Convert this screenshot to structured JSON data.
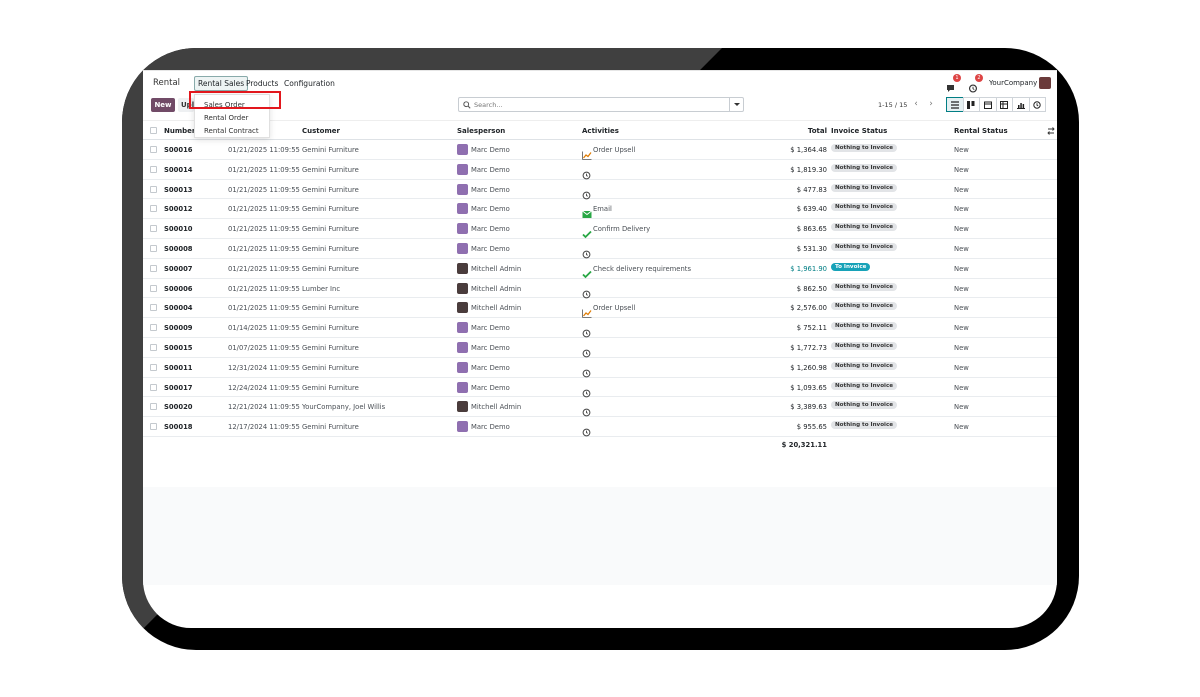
{
  "navbar": {
    "brand": "Rental",
    "menus": [
      "Rental Sales",
      "Products",
      "Configuration"
    ],
    "messages_count": "1",
    "activities_count": "2",
    "company": "YourCompany"
  },
  "dropdown": {
    "items": [
      "Sales Order",
      "Rental Order",
      "Rental Contract"
    ]
  },
  "control": {
    "new_label": "New",
    "upload_label": "Upload",
    "search_placeholder": "Search...",
    "pager": "1-15 / 15"
  },
  "columns": [
    "Number",
    "Customer",
    "Salesperson",
    "Activities",
    "Total",
    "Invoice Status",
    "Rental Status"
  ],
  "rows": [
    {
      "number": "S00016",
      "date": "01/21/2025 11:09:55",
      "customer": "Gemini Furniture",
      "salesperson": "Marc Demo",
      "activity": "Order Upsell",
      "activity_icon": "chart-icon",
      "total": "$ 1,364.48",
      "invoice": "Nothing to Invoice",
      "rental": "New"
    },
    {
      "number": "S00014",
      "date": "01/21/2025 11:09:55",
      "customer": "Gemini Furniture",
      "salesperson": "Marc Demo",
      "activity": "",
      "activity_icon": "clock-icon",
      "total": "$ 1,819.30",
      "invoice": "Nothing to Invoice",
      "rental": "New"
    },
    {
      "number": "S00013",
      "date": "01/21/2025 11:09:55",
      "customer": "Gemini Furniture",
      "salesperson": "Marc Demo",
      "activity": "",
      "activity_icon": "clock-icon",
      "total": "$ 477.83",
      "invoice": "Nothing to Invoice",
      "rental": "New"
    },
    {
      "number": "S00012",
      "date": "01/21/2025 11:09:55",
      "customer": "Gemini Furniture",
      "salesperson": "Marc Demo",
      "activity": "Email",
      "activity_icon": "envelope-icon",
      "total": "$ 639.40",
      "invoice": "Nothing to Invoice",
      "rental": "New"
    },
    {
      "number": "S00010",
      "date": "01/21/2025 11:09:55",
      "customer": "Gemini Furniture",
      "salesperson": "Marc Demo",
      "activity": "Confirm Delivery",
      "activity_icon": "check-icon",
      "total": "$ 863.65",
      "invoice": "Nothing to Invoice",
      "rental": "New"
    },
    {
      "number": "S00008",
      "date": "01/21/2025 11:09:55",
      "customer": "Gemini Furniture",
      "salesperson": "Marc Demo",
      "activity": "",
      "activity_icon": "clock-icon",
      "total": "$ 531.30",
      "invoice": "Nothing to Invoice",
      "rental": "New"
    },
    {
      "number": "S00007",
      "date": "01/21/2025 11:09:55",
      "customer": "Gemini Furniture",
      "salesperson": "Mitchell Admin",
      "activity": "Check delivery requirements",
      "activity_icon": "check-icon",
      "total": "$ 1,961.90",
      "invoice": "To Invoice",
      "rental": "New"
    },
    {
      "number": "S00006",
      "date": "01/21/2025 11:09:55",
      "customer": "Lumber Inc",
      "salesperson": "Mitchell Admin",
      "activity": "",
      "activity_icon": "clock-icon",
      "total": "$ 862.50",
      "invoice": "Nothing to Invoice",
      "rental": "New"
    },
    {
      "number": "S00004",
      "date": "01/21/2025 11:09:55",
      "customer": "Gemini Furniture",
      "salesperson": "Mitchell Admin",
      "activity": "Order Upsell",
      "activity_icon": "chart-icon",
      "total": "$ 2,576.00",
      "invoice": "Nothing to Invoice",
      "rental": "New"
    },
    {
      "number": "S00009",
      "date": "01/14/2025 11:09:55",
      "customer": "Gemini Furniture",
      "salesperson": "Marc Demo",
      "activity": "",
      "activity_icon": "clock-icon",
      "total": "$ 752.11",
      "invoice": "Nothing to Invoice",
      "rental": "New"
    },
    {
      "number": "S00015",
      "date": "01/07/2025 11:09:55",
      "customer": "Gemini Furniture",
      "salesperson": "Marc Demo",
      "activity": "",
      "activity_icon": "clock-icon",
      "total": "$ 1,772.73",
      "invoice": "Nothing to Invoice",
      "rental": "New"
    },
    {
      "number": "S00011",
      "date": "12/31/2024 11:09:55",
      "customer": "Gemini Furniture",
      "salesperson": "Marc Demo",
      "activity": "",
      "activity_icon": "clock-icon",
      "total": "$ 1,260.98",
      "invoice": "Nothing to Invoice",
      "rental": "New"
    },
    {
      "number": "S00017",
      "date": "12/24/2024 11:09:55",
      "customer": "Gemini Furniture",
      "salesperson": "Marc Demo",
      "activity": "",
      "activity_icon": "clock-icon",
      "total": "$ 1,093.65",
      "invoice": "Nothing to Invoice",
      "rental": "New"
    },
    {
      "number": "S00020",
      "date": "12/21/2024 11:09:55",
      "customer": "YourCompany, Joel Willis",
      "salesperson": "Mitchell Admin",
      "activity": "",
      "activity_icon": "clock-icon",
      "total": "$ 3,389.63",
      "invoice": "Nothing to Invoice",
      "rental": "New"
    },
    {
      "number": "S00018",
      "date": "12/17/2024 11:09:55",
      "customer": "Gemini Furniture",
      "salesperson": "Marc Demo",
      "activity": "",
      "activity_icon": "clock-icon",
      "total": "$ 955.65",
      "invoice": "Nothing to Invoice",
      "rental": "New"
    }
  ],
  "grand_total": "$ 20,321.11",
  "colors": {
    "primary": "#714B67",
    "teal": "#017e84",
    "highlight": "#e2171d"
  }
}
